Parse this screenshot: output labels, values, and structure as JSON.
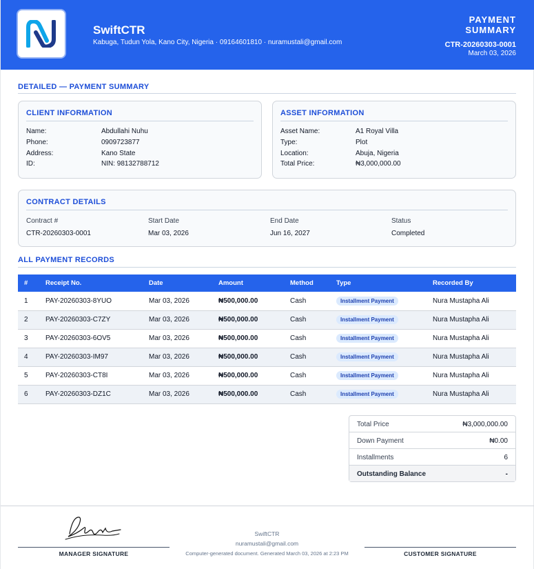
{
  "colors": {
    "brand": "#2563eb",
    "heading": "#1d4ed8",
    "badge_bg": "#dbeafe",
    "badge_text": "#1e40af"
  },
  "header": {
    "logo_icon": "N-logo-icon",
    "brand": "SwiftCTR",
    "address_line": "Kabuga, Tudun Yola, Kano City, Nigeria · 09164601810 · nuramustali@gmail.com",
    "title": "PAYMENT SUMMARY",
    "reference": "CTR-20260303-0001",
    "date": "March 03, 2026"
  },
  "section_title": "DETAILED — PAYMENT SUMMARY",
  "client": {
    "title": "CLIENT INFORMATION",
    "rows": [
      {
        "label": "Name:",
        "value": "Abdullahi Nuhu"
      },
      {
        "label": "Phone:",
        "value": "0909723877"
      },
      {
        "label": "Address:",
        "value": "Kano State"
      },
      {
        "label": "ID:",
        "value": "NIN: 98132788712"
      }
    ]
  },
  "asset": {
    "title": "ASSET INFORMATION",
    "rows": [
      {
        "label": "Asset Name:",
        "value": "A1 Royal Villa"
      },
      {
        "label": "Type:",
        "value": "Plot"
      },
      {
        "label": "Location:",
        "value": "Abuja, Nigeria"
      },
      {
        "label": "Total Price:",
        "value": "₦3,000,000.00"
      }
    ]
  },
  "contract": {
    "title": "CONTRACT DETAILS",
    "fields": [
      {
        "label": "Contract #",
        "value": "CTR-20260303-0001"
      },
      {
        "label": "Start Date",
        "value": "Mar 03, 2026"
      },
      {
        "label": "End Date",
        "value": "Jun 16, 2027"
      },
      {
        "label": "Status",
        "value": "Completed"
      }
    ]
  },
  "records": {
    "title": "ALL PAYMENT RECORDS",
    "columns": [
      "#",
      "Receipt No.",
      "Date",
      "Amount",
      "Method",
      "Type",
      "Recorded By"
    ],
    "rows": [
      {
        "num": "1",
        "receipt": "PAY-20260303-8YUO",
        "date": "Mar 03, 2026",
        "amount": "₦500,000.00",
        "method": "Cash",
        "type": "Installment Payment",
        "recorded_by": "Nura Mustapha Ali"
      },
      {
        "num": "2",
        "receipt": "PAY-20260303-C7ZY",
        "date": "Mar 03, 2026",
        "amount": "₦500,000.00",
        "method": "Cash",
        "type": "Installment Payment",
        "recorded_by": "Nura Mustapha Ali"
      },
      {
        "num": "3",
        "receipt": "PAY-20260303-6OV5",
        "date": "Mar 03, 2026",
        "amount": "₦500,000.00",
        "method": "Cash",
        "type": "Installment Payment",
        "recorded_by": "Nura Mustapha Ali"
      },
      {
        "num": "4",
        "receipt": "PAY-20260303-IM97",
        "date": "Mar 03, 2026",
        "amount": "₦500,000.00",
        "method": "Cash",
        "type": "Installment Payment",
        "recorded_by": "Nura Mustapha Ali"
      },
      {
        "num": "5",
        "receipt": "PAY-20260303-CT8I",
        "date": "Mar 03, 2026",
        "amount": "₦500,000.00",
        "method": "Cash",
        "type": "Installment Payment",
        "recorded_by": "Nura Mustapha Ali"
      },
      {
        "num": "6",
        "receipt": "PAY-20260303-DZ1C",
        "date": "Mar 03, 2026",
        "amount": "₦500,000.00",
        "method": "Cash",
        "type": "Installment Payment",
        "recorded_by": "Nura Mustapha Ali"
      }
    ]
  },
  "summary": {
    "rows": [
      {
        "label": "Total Price",
        "value": "₦3,000,000.00"
      },
      {
        "label": "Down Payment",
        "value": "₦0.00"
      },
      {
        "label": "Installments",
        "value": "6"
      },
      {
        "label": "Outstanding Balance",
        "value": "-"
      }
    ]
  },
  "footer": {
    "manager_label": "MANAGER SIGNATURE",
    "customer_label": "CUSTOMER SIGNATURE",
    "company": "SwiftCTR",
    "email": "nuramustali@gmail.com",
    "note": "Computer-generated document. Generated March 03, 2026 at 2:23 PM"
  }
}
